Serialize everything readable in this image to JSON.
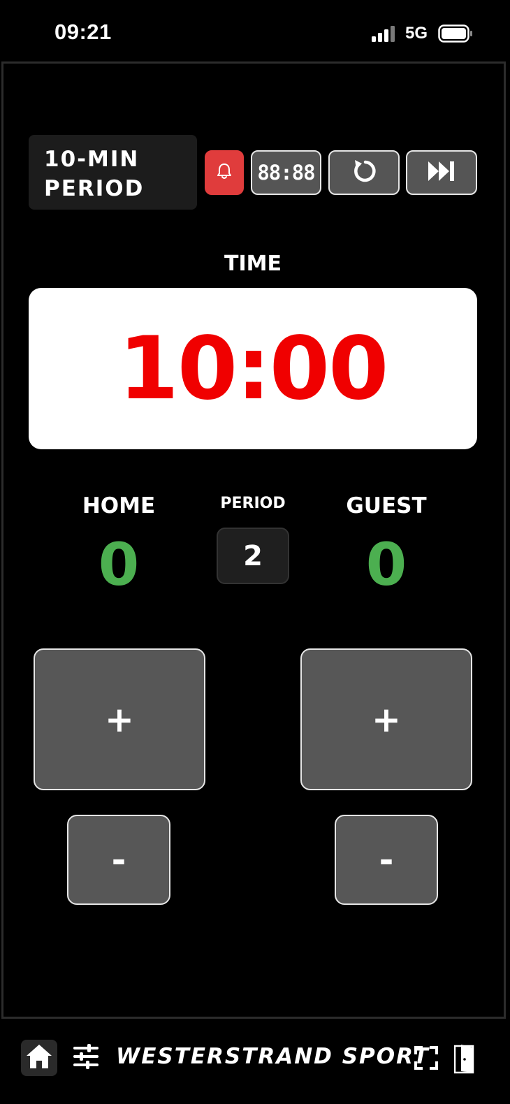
{
  "status_bar": {
    "time": "09:21",
    "network": "5G",
    "icons": [
      "signal-icon",
      "battery-icon"
    ]
  },
  "toolbar": {
    "period_length": "10-MIN\nPERIOD",
    "horn_icon": "bell-icon",
    "display_mode_label": "88:88",
    "reset_icon": "rotate-left-icon",
    "next_icon": "skip-forward-icon",
    "horn_color": "#e03c3c"
  },
  "clock": {
    "label": "TIME",
    "value": "10:00",
    "color": "#f00000"
  },
  "scoreboard": {
    "home": {
      "label": "HOME",
      "score": "0",
      "plus_label": "+",
      "minus_label": "-"
    },
    "guest": {
      "label": "GUEST",
      "score": "0",
      "plus_label": "+",
      "minus_label": "-"
    },
    "period": {
      "label": "PERIOD",
      "value": "2"
    },
    "score_color": "#4caf50"
  },
  "bottom_bar": {
    "brand": "WESTERSTRAND SPORT",
    "icons": [
      "home-icon",
      "sliders-icon",
      "fullscreen-icon",
      "exit-door-icon"
    ]
  }
}
